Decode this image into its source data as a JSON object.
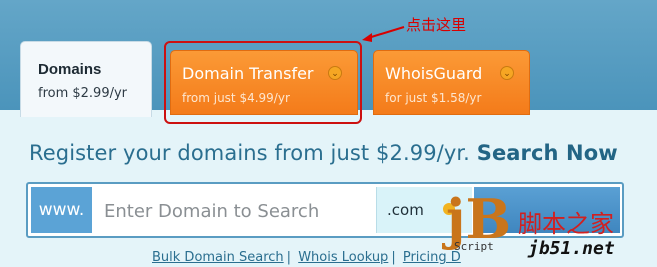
{
  "annotation": {
    "text": "点击这里",
    "color": "#d80000"
  },
  "tabs": [
    {
      "title": "Domains",
      "subtitle": "from $2.99/yr",
      "active": true
    },
    {
      "title": "Domain Transfer",
      "subtitle": "from just $4.99/yr",
      "active": false
    },
    {
      "title": "WhoisGuard",
      "subtitle": "for just $1.58/yr",
      "active": false
    }
  ],
  "headline": {
    "text": "Register your domains from just $2.99/yr.",
    "cta": "Search Now"
  },
  "search": {
    "prefix": "www.",
    "placeholder": "Enter Domain to Search",
    "tld": ".com"
  },
  "links": [
    "Bulk Domain Search",
    "Whois Lookup",
    "Pricing D"
  ],
  "watermark": {
    "logo": "jB",
    "script": "Script",
    "site_cn": "脚本之家",
    "url": "jb51.net"
  },
  "colors": {
    "accent_orange": "#f47b1a",
    "link_blue": "#2a6e8f",
    "band_blue": "#4b94bb"
  }
}
